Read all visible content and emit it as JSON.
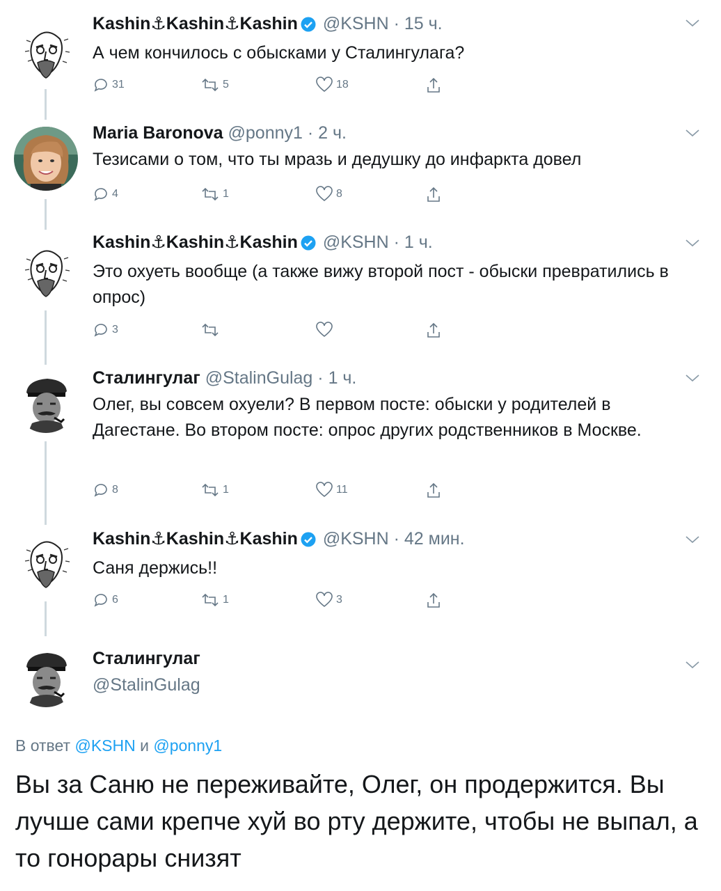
{
  "tweets": [
    {
      "name": "Kashin⚓Kashin⚓Kashin",
      "handle": "@KSHN",
      "time": "15 ч.",
      "text": "А чем кончилось с обысками у Сталингулага?",
      "replies": "31",
      "retweets": "5",
      "likes": "18",
      "verified": true,
      "avatar": "sketch-avatar"
    },
    {
      "name": "Maria Baronova",
      "handle": "@ponny1",
      "time": "2 ч.",
      "text": "Тезисами о том, что ты мразь и дедушку до инфаркта довел",
      "replies": "4",
      "retweets": "1",
      "likes": "8",
      "verified": false,
      "avatar": "photo-avatar"
    },
    {
      "name": "Kashin⚓Kashin⚓Kashin",
      "handle": "@KSHN",
      "time": "1 ч.",
      "text": "Это охуеть вообще (а также вижу второй пост - обыски превратились в опрос)",
      "replies": "3",
      "retweets": "",
      "likes": "",
      "verified": true,
      "avatar": "sketch-avatar"
    },
    {
      "name": "Сталингулаг",
      "handle": "@StalinGulag",
      "time": "1 ч.",
      "text": "Олег, вы совсем охуели? В первом посте: обыски у родителей в Дагестане. Во втором посте: опрос других родственников в Москве.",
      "replies": "8",
      "retweets": "1",
      "likes": "11",
      "verified": false,
      "avatar": "stalin-avatar"
    },
    {
      "name": "Kashin⚓Kashin⚓Kashin",
      "handle": "@KSHN",
      "time": "42 мин.",
      "text": "Саня держись!!",
      "replies": "6",
      "retweets": "1",
      "likes": "3",
      "verified": true,
      "avatar": "sketch-avatar"
    }
  ],
  "focused": {
    "name": "Сталингулаг",
    "handle": "@StalinGulag",
    "reply_prefix": "В ответ",
    "reply_mention_1": "@KSHN",
    "reply_and": "и",
    "reply_mention_2": "@ponny1",
    "text": "Вы за Саню не переживайте, Олег, он продержится. Вы лучше сами крепче хуй во рту держите, чтобы не выпал, а то гонорары снизят"
  },
  "colors": {
    "accent": "#1da1f2",
    "secondary_text": "#657786",
    "thread_line": "#cfd9de"
  }
}
